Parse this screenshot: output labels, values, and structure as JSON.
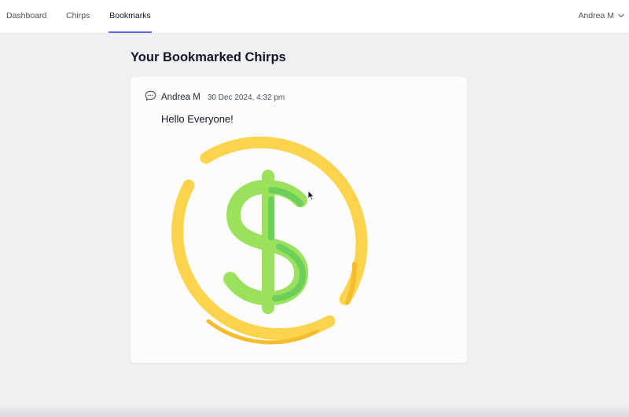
{
  "nav": {
    "items": [
      {
        "label": "Dashboard",
        "active": false
      },
      {
        "label": "Chirps",
        "active": false
      },
      {
        "label": "Bookmarks",
        "active": true
      }
    ],
    "user_name": "Andrea M"
  },
  "page": {
    "title": "Your Bookmarked Chirps"
  },
  "chirps": [
    {
      "author": "Andrea M",
      "timestamp": "30 Dec 2024, 4:32 pm",
      "message": "Hello Everyone!",
      "image_icon": "dollar-coin-icon"
    }
  ],
  "colors": {
    "accent": "#6366f1",
    "coin_ring": "#fcd34d",
    "coin_ring_shade": "#f5bd2e",
    "dollar_light": "#9be15d",
    "dollar_dark": "#6bcf5a",
    "background": "#eef0f2"
  },
  "icons": {
    "chirp": "chat-bubble-icon",
    "user_menu": "chevron-down-icon"
  }
}
